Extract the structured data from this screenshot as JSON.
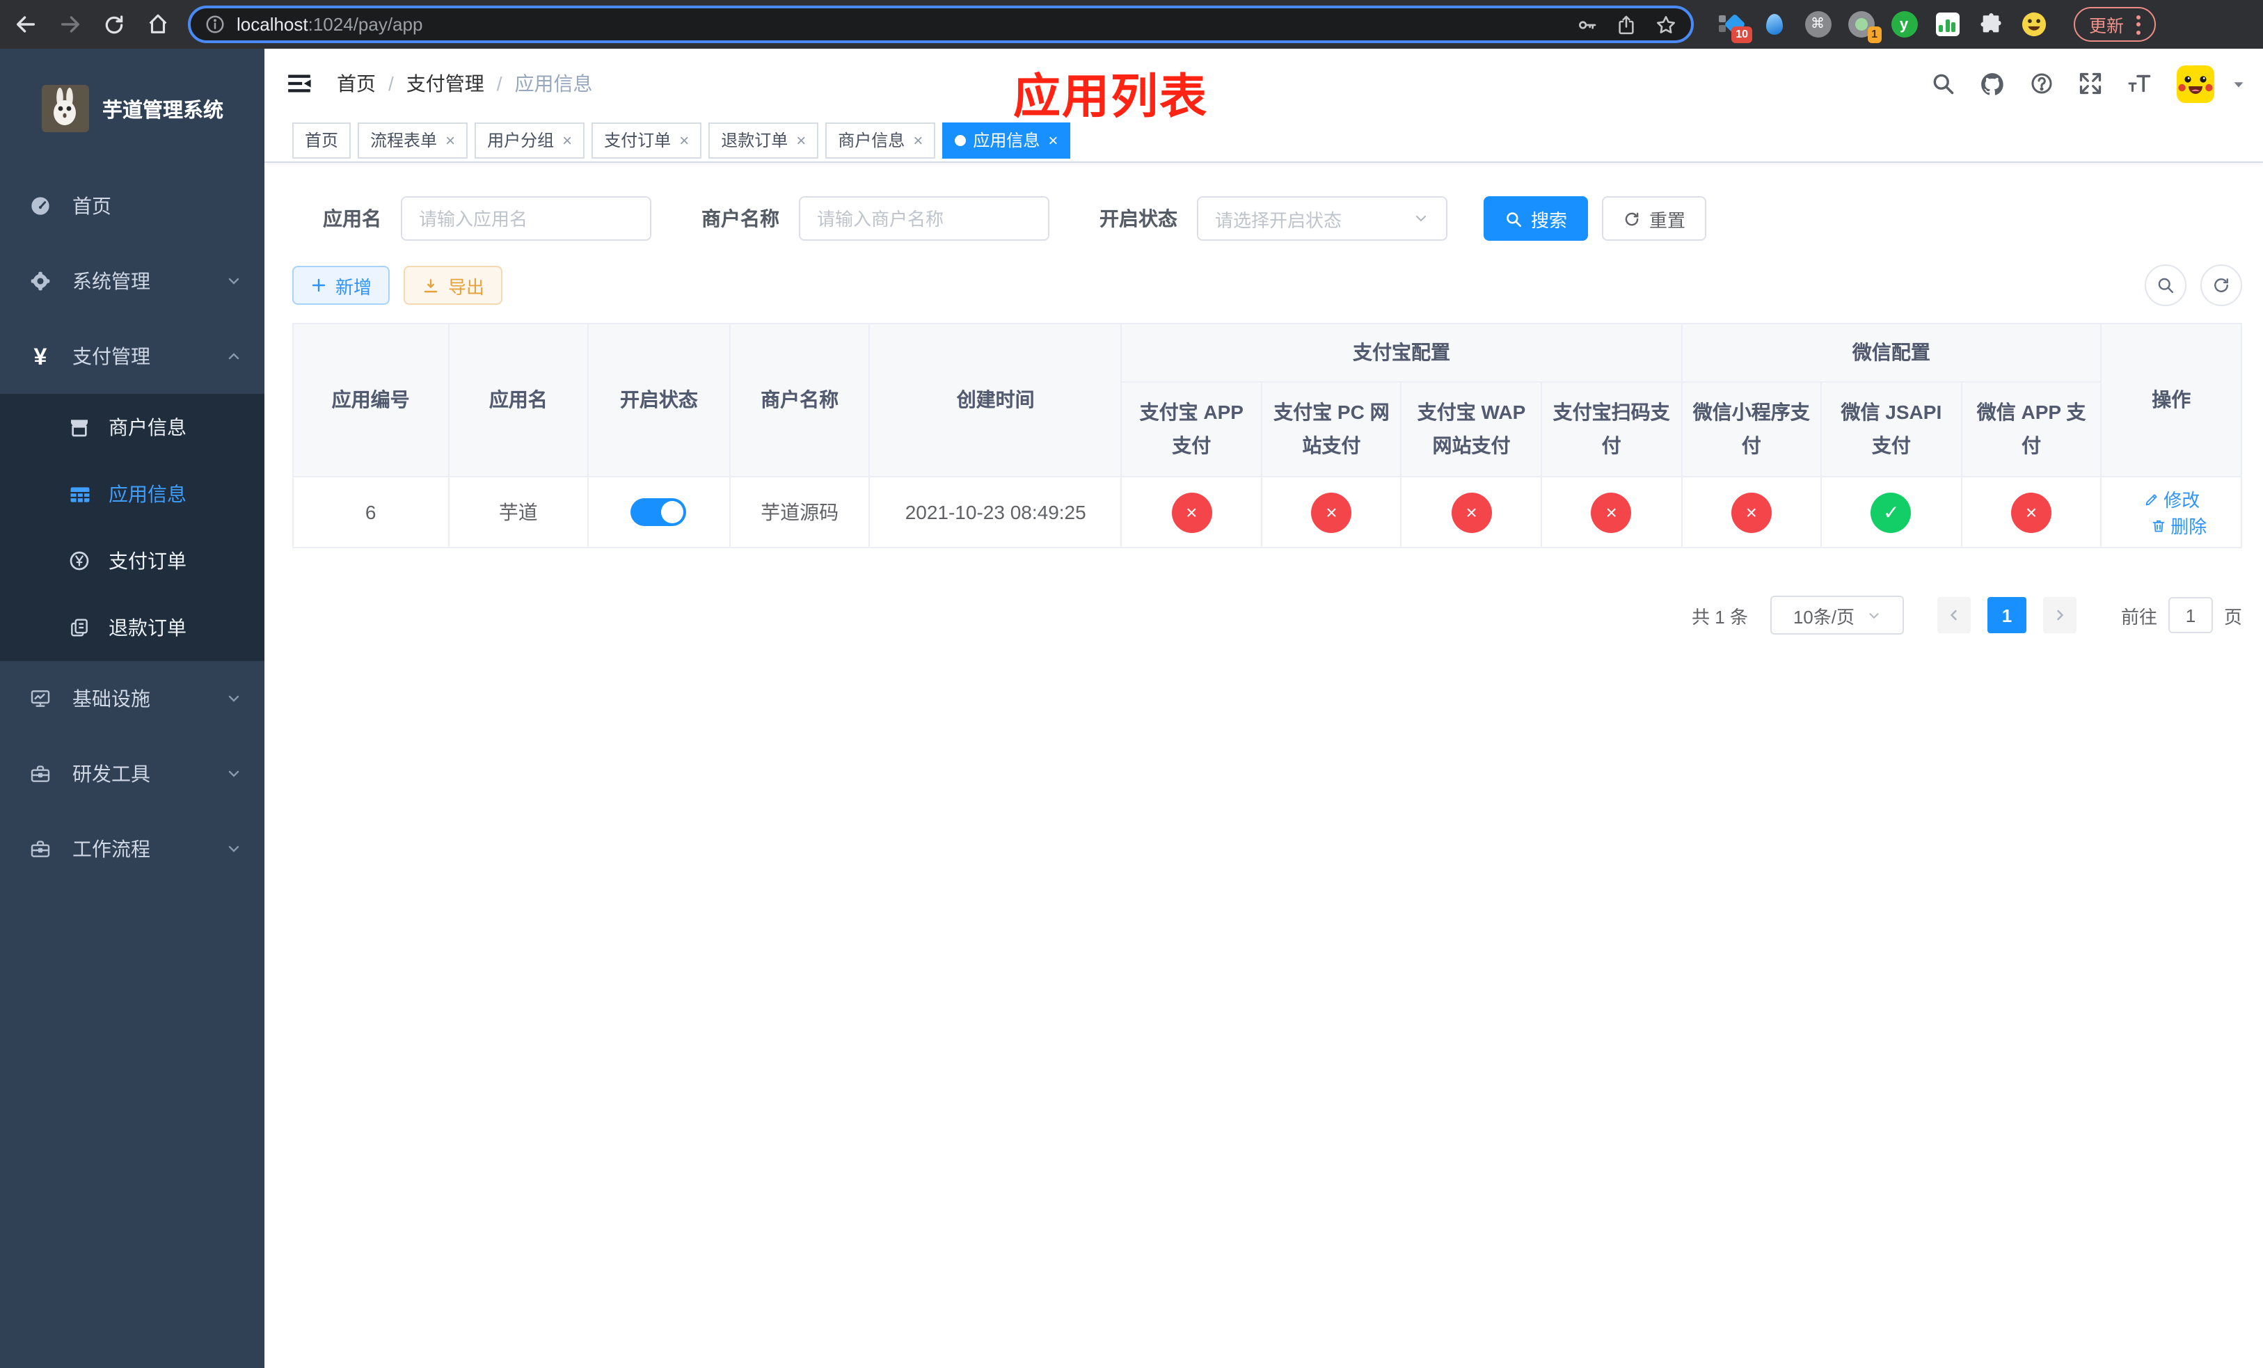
{
  "browser": {
    "url_host": "localhost",
    "url_rest": ":1024/pay/app",
    "update_label": "更新",
    "ext_badge_blue": "10",
    "ext_badge_camera": "1",
    "ext_letter": "y"
  },
  "sidebar": {
    "title": "芋道管理系统",
    "items": [
      {
        "label": "首页"
      },
      {
        "label": "系统管理"
      },
      {
        "label": "支付管理"
      },
      {
        "label": "基础设施"
      },
      {
        "label": "研发工具"
      },
      {
        "label": "工作流程"
      }
    ],
    "submenu": [
      {
        "label": "商户信息"
      },
      {
        "label": "应用信息"
      },
      {
        "label": "支付订单"
      },
      {
        "label": "退款订单"
      }
    ]
  },
  "header": {
    "breadcrumb": [
      "首页",
      "支付管理",
      "应用信息"
    ],
    "overlay_title": "应用列表"
  },
  "tabs": {
    "items": [
      {
        "label": "首页"
      },
      {
        "label": "流程表单"
      },
      {
        "label": "用户分组"
      },
      {
        "label": "支付订单"
      },
      {
        "label": "退款订单"
      },
      {
        "label": "商户信息"
      },
      {
        "label": "应用信息"
      }
    ]
  },
  "filters": {
    "app_name_label": "应用名",
    "app_name_placeholder": "请输入应用名",
    "merchant_label": "商户名称",
    "merchant_placeholder": "请输入商户名称",
    "status_label": "开启状态",
    "status_placeholder": "请选择开启状态",
    "search_label": "搜索",
    "reset_label": "重置"
  },
  "toolbar": {
    "add_label": "新增",
    "export_label": "导出"
  },
  "table": {
    "groups": {
      "alipay": "支付宝配置",
      "wechat": "微信配置"
    },
    "columns": [
      "应用编号",
      "应用名",
      "开启状态",
      "商户名称",
      "创建时间",
      "支付宝 APP 支付",
      "支付宝 PC 网站支付",
      "支付宝 WAP 网站支付",
      "支付宝扫码支付",
      "微信小程序支付",
      "微信 JSAPI 支付",
      "微信 APP 支付",
      "操作"
    ],
    "rows": [
      {
        "id": "6",
        "name": "芋道",
        "enabled": true,
        "merchant": "芋道源码",
        "created": "2021-10-23 08:49:25",
        "statuses": [
          "cross",
          "cross",
          "cross",
          "cross",
          "cross",
          "check",
          "cross"
        ]
      }
    ],
    "status_glyphs": {
      "cross": "×",
      "check": "✓"
    },
    "row_actions": {
      "edit": "修改",
      "delete": "删除"
    }
  },
  "pagination": {
    "total": "共 1 条",
    "page_size": "10条/页",
    "current": "1",
    "goto_label": "前往",
    "goto_value": "1",
    "page_unit": "页"
  },
  "colors": {
    "accent_blue": "#1890ff",
    "danger_red": "#f3454a",
    "success_green": "#13ce66",
    "warning_orange": "#e6a23c",
    "overlay_title_red": "#fe2312",
    "sidebar_bg": "#304156",
    "sidebar_submenu_bg": "#1f2d3d"
  }
}
